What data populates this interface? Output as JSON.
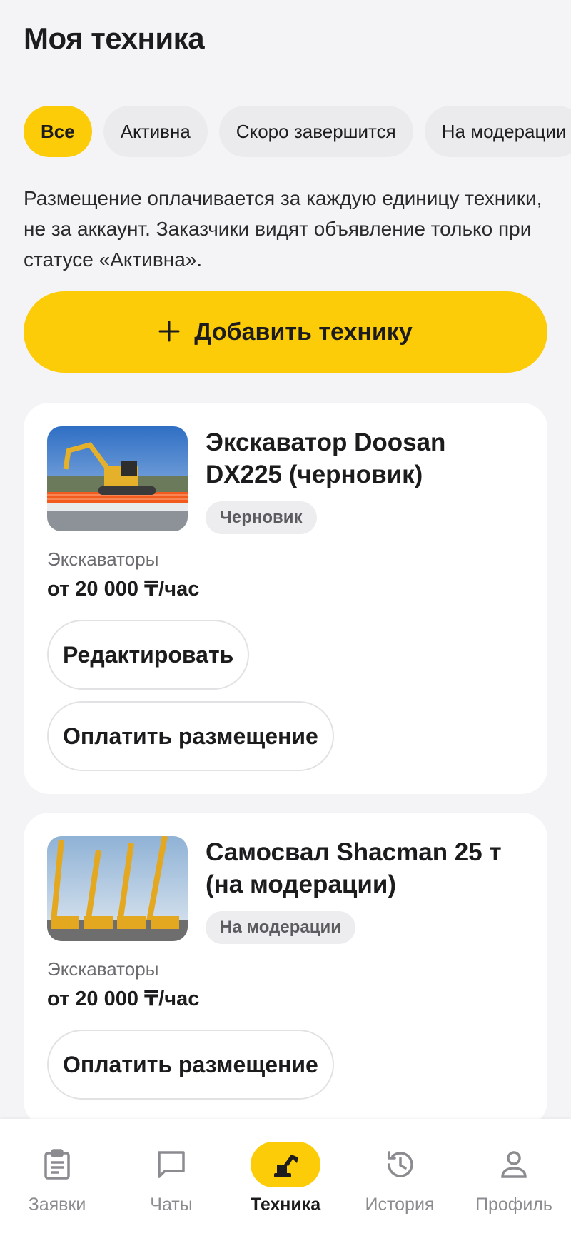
{
  "header": {
    "title": "Моя техника"
  },
  "filters": [
    {
      "label": "Все",
      "active": true
    },
    {
      "label": "Активна",
      "active": false
    },
    {
      "label": "Скоро завершится",
      "active": false
    },
    {
      "label": "На модерации",
      "active": false
    }
  ],
  "info_text": "Размещение оплачивается за каждую единицу техники, не за аккаунт. Заказчики видят объявление только при статусе «Активна».",
  "add_button": {
    "icon": "plus-icon",
    "label": "Добавить технику"
  },
  "listings": [
    {
      "title": "Экскаватор Doosan DX225 (черновик)",
      "status": "Черновик",
      "category": "Экскаваторы",
      "price": "от 20 000 ₸/час",
      "actions": [
        "Редактировать",
        "Оплатить размещение"
      ]
    },
    {
      "title": "Самосвал Shacman 25 т (на модерации)",
      "status": "На модерации",
      "category": "Экскаваторы",
      "price": "от 20 000 ₸/час",
      "actions": [
        "Оплатить размещение"
      ]
    }
  ],
  "bottom_nav": [
    {
      "label": "Заявки",
      "icon": "clipboard-icon",
      "active": false
    },
    {
      "label": "Чаты",
      "icon": "chat-icon",
      "active": false
    },
    {
      "label": "Техника",
      "icon": "excavator-icon",
      "active": true
    },
    {
      "label": "История",
      "icon": "history-icon",
      "active": false
    },
    {
      "label": "Профиль",
      "icon": "user-icon",
      "active": false
    }
  ],
  "colors": {
    "accent": "#fdcc09",
    "background": "#f4f4f6",
    "card": "#ffffff"
  }
}
